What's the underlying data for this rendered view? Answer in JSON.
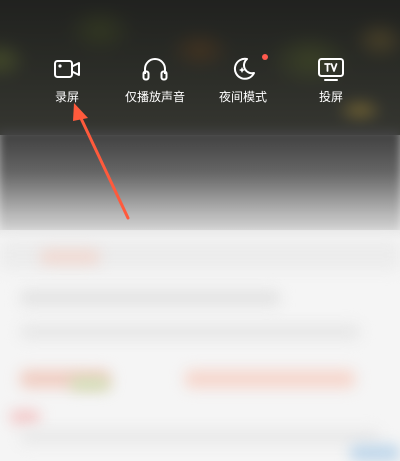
{
  "controls": [
    {
      "id": "record",
      "label": "录屏",
      "icon": "video-camera-icon"
    },
    {
      "id": "audio_only",
      "label": "仅播放声音",
      "icon": "headphones-icon"
    },
    {
      "id": "night_mode",
      "label": "夜间模式",
      "icon": "moon-icon",
      "badge": "red-dot"
    },
    {
      "id": "cast",
      "label": "投屏",
      "icon": "tv-icon"
    }
  ],
  "colors": {
    "icon": "#ffffff",
    "label": "#ffffff",
    "badge": "#ff5a4e",
    "annotation_arrow": "#ff5a3c"
  },
  "annotation": {
    "type": "arrow",
    "points_to": "record"
  }
}
